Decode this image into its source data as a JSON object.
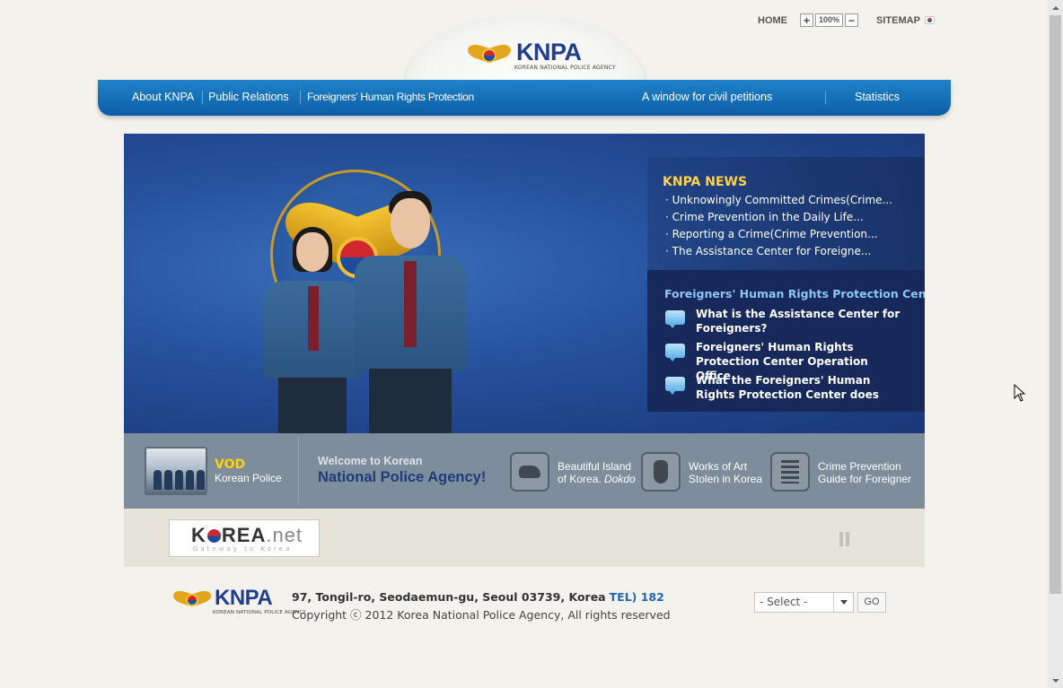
{
  "utility": {
    "home": "HOME",
    "zoom_in": "+",
    "zoom_value": "100%",
    "zoom_out": "−",
    "sitemap": "SITEMAP"
  },
  "logo": {
    "title": "KNPA",
    "subtitle": "KOREAN NATIONAL POLICE AGENCY"
  },
  "nav": {
    "items": [
      {
        "label": "About KNPA"
      },
      {
        "label": "Public Relations"
      },
      {
        "label": "Foreigners' Human Rights Protection"
      },
      {
        "label": "A window for civil  petitions"
      },
      {
        "label": "Statistics"
      }
    ]
  },
  "news": {
    "title": "KNPA NEWS",
    "items": [
      "· Unknowingly Committed Crimes(Crime...",
      "· Crime Prevention in the Daily Life...",
      "· Reporting a Crime(Crime Prevention...",
      "· The Assistance Center for Foreigne..."
    ]
  },
  "center": {
    "title": "Foreigners' Human Rights Protection Center",
    "items": [
      "What is the Assistance Center for Foreigners?",
      "Foreigners' Human Rights Protection Center Operation Office",
      "What the Foreigners' Human Rights Protection Center does"
    ]
  },
  "quick": {
    "vod_label": "VOD",
    "vod_sub": "Korean Police",
    "welcome_line1": "Welcome to Korean",
    "welcome_line2": "National Police Agency!",
    "links": [
      {
        "line1": "Beautiful Island",
        "line2": "of Korea. ",
        "line2_em": "Dokdo",
        "icon": "island-icon"
      },
      {
        "line1": "Works of Art",
        "line2": "Stolen in Korea",
        "line2_em": "",
        "icon": "vase-icon"
      },
      {
        "line1": "Crime  Prevention",
        "line2": "Guide  for  Foreigner",
        "line2_em": "",
        "icon": "guide-book-icon"
      }
    ]
  },
  "banner": {
    "korea_net_main_a": "K",
    "korea_net_main_b": "REA",
    "korea_net_main_c": ".net",
    "korea_net_sub": "Gateway to Korea"
  },
  "footer": {
    "address": "97, Tongil-ro, Seodaemun-gu, Seoul 03739, Korea",
    "tel": "TEL) 182",
    "copyright": "Copyright ⓒ 2012 Korea National Police Agency, All rights reserved",
    "select_value": "- Select -",
    "go_label": "GO"
  }
}
